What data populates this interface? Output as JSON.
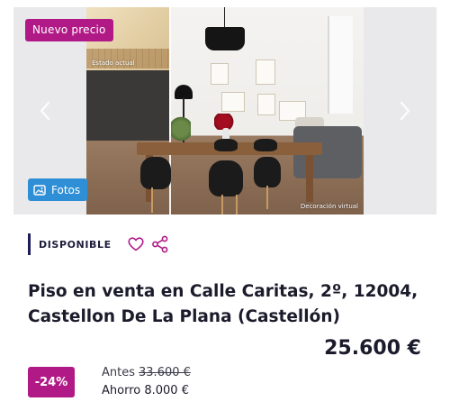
{
  "gallery": {
    "badge": "Nuevo precio",
    "photos_label": "Fotos",
    "before_label": "Estado actual",
    "decoration_label": "Decoración virtual",
    "badge_color": "#b11a86",
    "photos_button_color": "#2f8fd6"
  },
  "status": {
    "label": "DISPONIBLE"
  },
  "listing": {
    "title": "Piso en venta en Calle Caritas, 2º, 12004, Castellon De La Plana (Castellón)",
    "price": "25.600 €",
    "discount": "-24%",
    "before_prefix": "Antes",
    "before_price": "33.600 €",
    "saving": "Ahorro 8.000 €"
  }
}
